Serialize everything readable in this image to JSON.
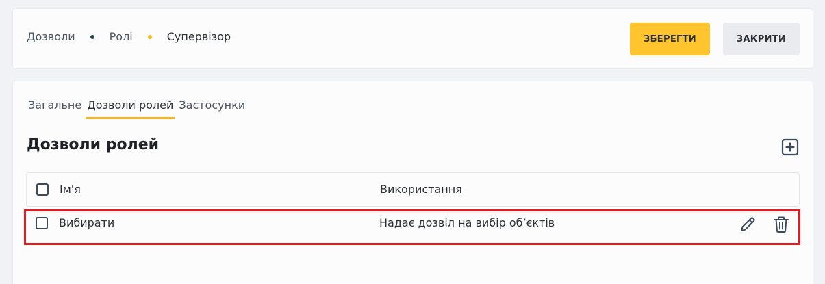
{
  "header": {
    "breadcrumb": [
      "Дозволи",
      "Ролі",
      "Супервізор"
    ],
    "save_label": "ЗБЕРЕГТИ",
    "close_label": "ЗАКРИТИ"
  },
  "tabs": [
    {
      "label": "Загальне",
      "active": false
    },
    {
      "label": "Дозволи ролей",
      "active": true
    },
    {
      "label": "Застосунки",
      "active": false
    }
  ],
  "section": {
    "title": "Дозволи ролей",
    "add_icon": "plus-square-icon"
  },
  "table": {
    "columns": [
      "Ім'я",
      "Використання"
    ],
    "rows": [
      {
        "name": "Вибирати",
        "usage": "Надає дозвіл на вибір об’єктів",
        "actions": [
          "pencil-icon",
          "trash-icon"
        ]
      }
    ]
  },
  "colors": {
    "accent": "#ffc42e",
    "dot_dark": "#2f4858",
    "dot_accent": "#f5b71a",
    "highlight": "#e21b23",
    "icon": "#3b4a5c"
  }
}
